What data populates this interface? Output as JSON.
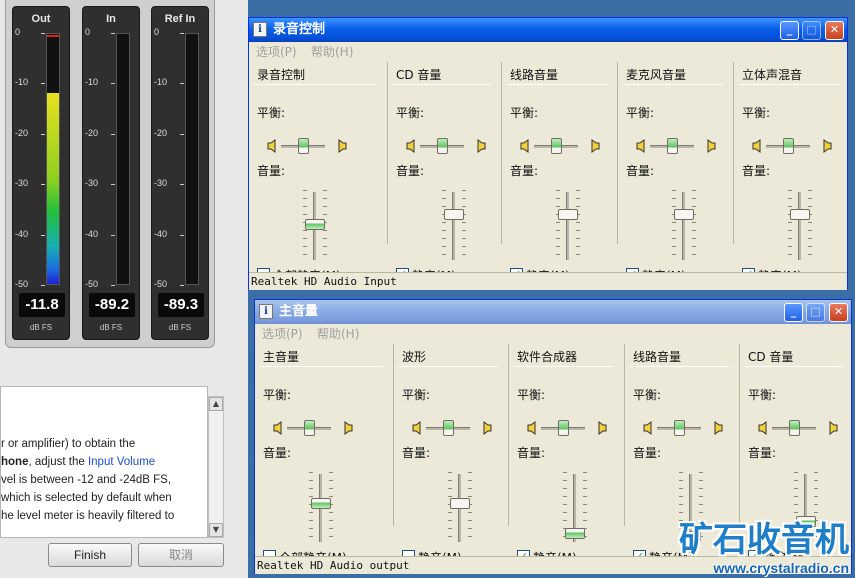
{
  "meters": [
    {
      "title": "Out",
      "readout": "-11.8",
      "unit": "dB FS",
      "level_db": -11.8,
      "peak_db": -0.5
    },
    {
      "title": "In",
      "readout": "-89.2",
      "unit": "dB FS",
      "level_db": -89.2,
      "peak_db": null
    },
    {
      "title": "Ref In",
      "readout": "-89.3",
      "unit": "dB FS",
      "level_db": -89.3,
      "peak_db": null
    }
  ],
  "meter_scale": {
    "ticks": [
      "0",
      "-10",
      "-20",
      "-30",
      "-40",
      "-50"
    ],
    "min_db": -50,
    "max_db": 0
  },
  "help": {
    "line1": "r or amplifier) to obtain the",
    "line2_bold": "hone",
    "line2_mid": ", adjust the ",
    "line2_link": "Input Volume",
    "line3": "vel is between -12 and -24dB FS,",
    "line4": "which is selected by default when",
    "line5": "he level meter is heavily filtered to"
  },
  "buttons": {
    "finish": "Finish",
    "cancel": "取消"
  },
  "recording_window": {
    "title": "录音控制",
    "menu": [
      "选项(P)",
      "帮助(H)"
    ],
    "channels": [
      {
        "title": "录音控制",
        "balance_label": "平衡:",
        "volume_label": "音量:",
        "check_label": "全部静音(M)",
        "checked": false,
        "volume": 0.55,
        "balance": 0.5
      },
      {
        "title": "CD 音量",
        "balance_label": "平衡:",
        "volume_label": "音量:",
        "check_label": "静音(M)",
        "checked": true,
        "volume": 0.72,
        "balance": 0.5
      },
      {
        "title": "线路音量",
        "balance_label": "平衡:",
        "volume_label": "音量:",
        "check_label": "静音(M)",
        "checked": true,
        "volume": 0.72,
        "balance": 0.5
      },
      {
        "title": "麦克风音量",
        "balance_label": "平衡:",
        "volume_label": "音量:",
        "check_label": "静音(M)",
        "checked": true,
        "volume": 0.72,
        "balance": 0.5
      },
      {
        "title": "立体声混音",
        "balance_label": "平衡:",
        "volume_label": "音量:",
        "check_label": "静音(M)",
        "checked": true,
        "volume": 0.72,
        "balance": 0.5
      }
    ],
    "status": "Realtek HD Audio Input"
  },
  "master_window": {
    "title": "主音量",
    "menu": [
      "选项(P)",
      "帮助(H)"
    ],
    "channels": [
      {
        "title": "主音量",
        "balance_label": "平衡:",
        "volume_label": "音量:",
        "check_label": "全部静音(M)",
        "checked": false,
        "volume": 0.6,
        "balance": 0.5
      },
      {
        "title": "波形",
        "balance_label": "平衡:",
        "volume_label": "音量:",
        "check_label": "静音(M)",
        "checked": false,
        "volume": 0.6,
        "balance": 0.5
      },
      {
        "title": "软件合成器",
        "balance_label": "平衡:",
        "volume_label": "音量:",
        "check_label": "静音(M)",
        "checked": true,
        "volume": 0.1,
        "balance": 0.5
      },
      {
        "title": "线路音量",
        "balance_label": "平衡:",
        "volume_label": "音量:",
        "check_label": "静音(M)",
        "checked": true,
        "volume": 0.05,
        "balance": 0.5
      },
      {
        "title": "CD 音量",
        "balance_label": "平衡:",
        "volume_label": "音量:",
        "check_label": "静音(M)",
        "checked": true,
        "volume": 0.3,
        "balance": 0.5
      }
    ],
    "status": "Realtek HD Audio output"
  },
  "watermark": {
    "text": "矿石收音机",
    "url": "www.crystalradio.cn"
  },
  "colors": {
    "titlebar": "#0a5ee8",
    "window_bg": "#ece9d8",
    "meter_bg": "#2f2f2f",
    "link": "#1f4fd0",
    "watermark": "#1e7ec8"
  }
}
